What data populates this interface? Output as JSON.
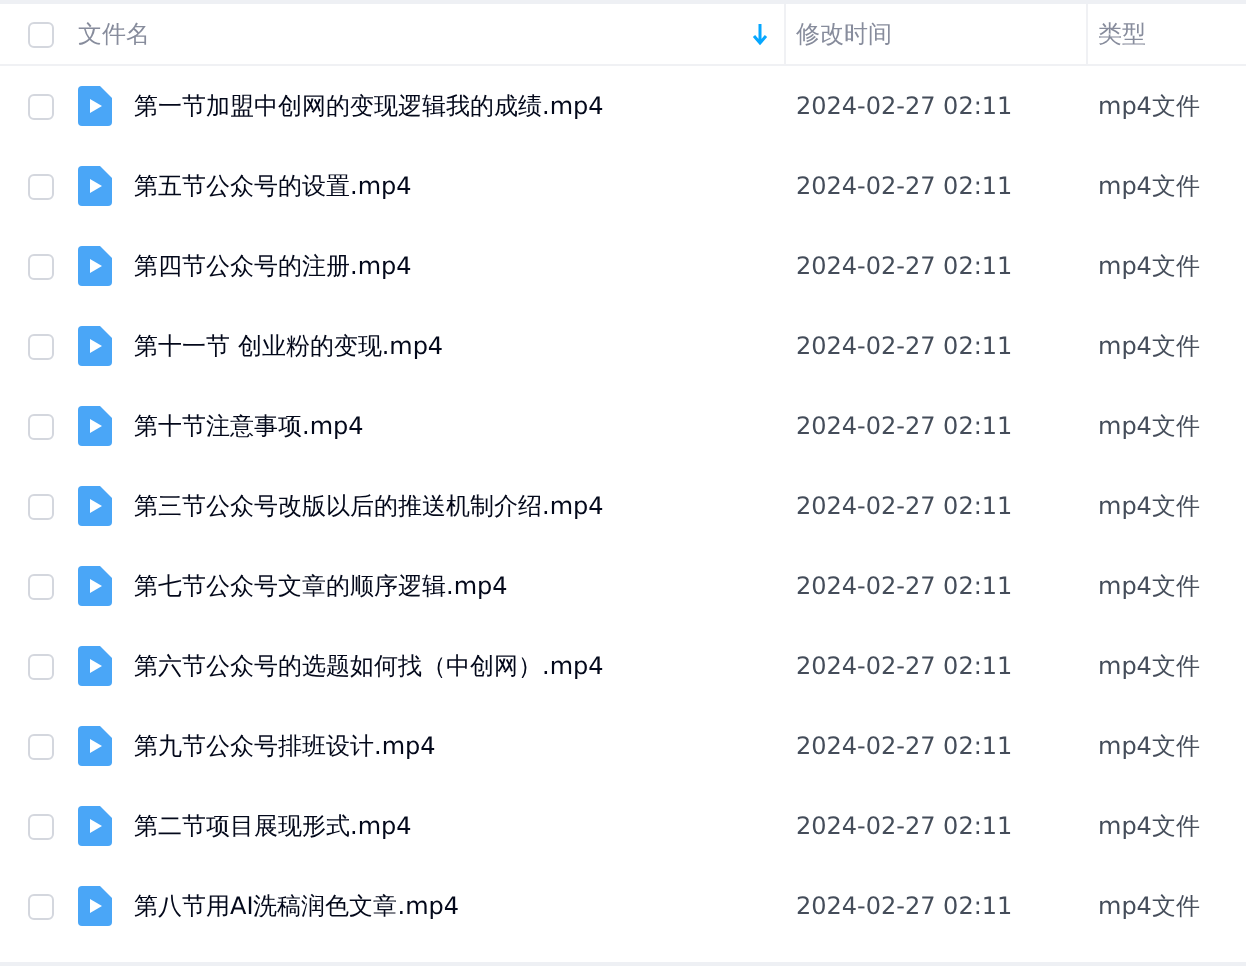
{
  "columns": [
    {
      "label": "文件名",
      "sorted": true
    },
    {
      "label": "修改时间",
      "sorted": false
    },
    {
      "label": "类型",
      "sorted": false
    }
  ],
  "select_all": {
    "checked": false
  },
  "rows": [
    {
      "name": "第一节加盟中创网的变现逻辑我的成绩.mp4",
      "modified": "2024-02-27 02:11",
      "type": "mp4文件",
      "checked": false
    },
    {
      "name": "第五节公众号的设置.mp4",
      "modified": "2024-02-27 02:11",
      "type": "mp4文件",
      "checked": false
    },
    {
      "name": "第四节公众号的注册.mp4",
      "modified": "2024-02-27 02:11",
      "type": "mp4文件",
      "checked": false
    },
    {
      "name": "第十一节 创业粉的变现.mp4",
      "modified": "2024-02-27 02:11",
      "type": "mp4文件",
      "checked": false
    },
    {
      "name": "第十节注意事项.mp4",
      "modified": "2024-02-27 02:11",
      "type": "mp4文件",
      "checked": false
    },
    {
      "name": "第三节公众号改版以后的推送机制介绍.mp4",
      "modified": "2024-02-27 02:11",
      "type": "mp4文件",
      "checked": false
    },
    {
      "name": "第七节公众号文章的顺序逻辑.mp4",
      "modified": "2024-02-27 02:11",
      "type": "mp4文件",
      "checked": false
    },
    {
      "name": "第六节公众号的选题如何找（中创网）.mp4",
      "modified": "2024-02-27 02:11",
      "type": "mp4文件",
      "checked": false
    },
    {
      "name": "第九节公众号排班设计.mp4",
      "modified": "2024-02-27 02:11",
      "type": "mp4文件",
      "checked": false
    },
    {
      "name": "第二节项目展现形式.mp4",
      "modified": "2024-02-27 02:11",
      "type": "mp4文件",
      "checked": false
    },
    {
      "name": "第八节用AI洗稿润色文章.mp4",
      "modified": "2024-02-27 02:11",
      "type": "mp4文件",
      "checked": false
    }
  ]
}
